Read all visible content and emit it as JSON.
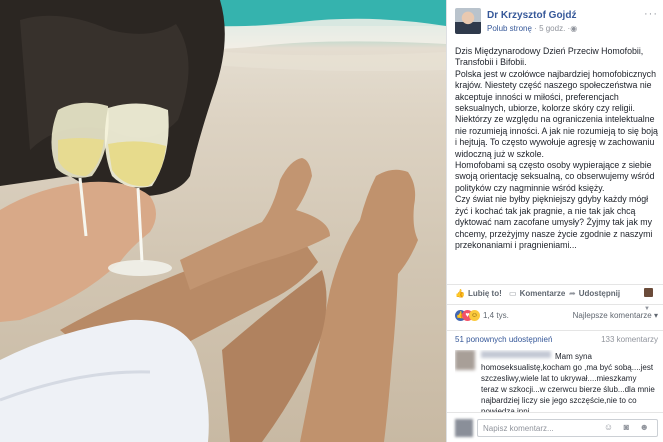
{
  "post": {
    "author": "Dr Krzysztof Gojdź",
    "like_page": "Polub stronę",
    "separator": "·",
    "time": "5 godz.",
    "globe_icon": "globe-icon",
    "menu": "···",
    "paragraphs": [
      "Dzis Międzynarodowy Dzień Przeciw Homofobii, Transfobii i Bifobii.",
      "Polska jest w czołówce najbardziej homofobicznych krajów. Niestety część naszego społeczeństwa nie akceptuje inności w miłości, preferencjach seksualnych, ubiorze, kolorze skóry czy religii. Niektórzy ze względu na ograniczenia intelektualne nie rozumieją inności. A jak nie rozumieją to się boją i hejtują. To często wywołuje agresję w zachowaniu widoczną już w szkole.",
      "Homofobami są często osoby wypierające z siebie swoją orientację seksualną, co obserwujemy wśród polityków czy nagminnie wśród księży.",
      "Czy świat nie byłby piękniejszy gdyby każdy mógł żyć i kochać tak jak pragnie, a nie tak jak chcą dyktować nam zacofane umysły? Żyjmy tak jak my chcemy, przeżyjmy nasze życie zgodnie z naszymi przekonaniami i pragnieniami..."
    ]
  },
  "actions": {
    "like": "Lubię to!",
    "comment": "Komentarze",
    "share": "Udostępnij",
    "caret": "▼"
  },
  "reactions": {
    "count": "1,4 tys.",
    "sort": "Najlepsze komentarze ▾"
  },
  "stats": {
    "shares": "51 ponownych udostępnień",
    "comments": "133 komentarzy"
  },
  "comment": {
    "text": "Mam syna homoseksualistę,kocham go ,ma być sobą....jest szczesliwy,wiele lat to ukrywał....mieszkamy teraz w szkocji...w czerwcu bierze ślub...dla mnie najbardziej liczy sie jego szczęście,nie to co powiedzą inni"
  },
  "composer": {
    "placeholder": "Napisz komentarz...",
    "icons": "☺ ◙ ☻"
  },
  "colors": {
    "link": "#365899",
    "like_reaction": "#4267b2",
    "love_reaction": "#f25268",
    "haha_reaction": "#fbc93d",
    "sea": "#3fb8b4",
    "sand": "#ddd3c3"
  }
}
